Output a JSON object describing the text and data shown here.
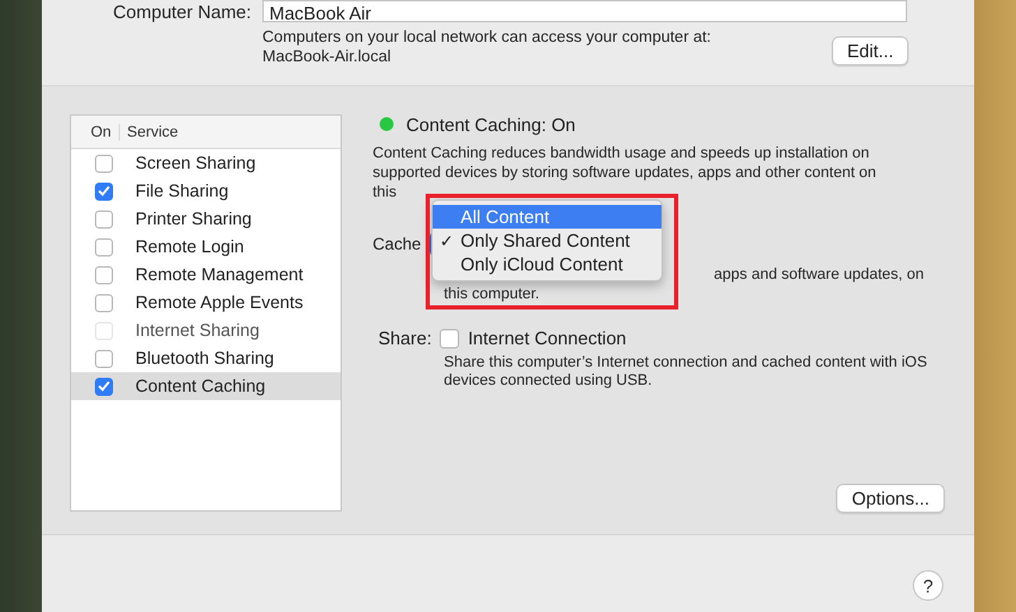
{
  "computer_name": {
    "label": "Computer Name:",
    "value": "MacBook Air"
  },
  "network_note": [
    "Computers on your local network can access your computer at:",
    "MacBook-Air.local"
  ],
  "edit_button": "Edit...",
  "services": {
    "columns": [
      "On",
      "Service"
    ],
    "rows": [
      {
        "name": "Screen Sharing",
        "checked": false,
        "disabled": false,
        "selected": false
      },
      {
        "name": "File Sharing",
        "checked": true,
        "disabled": false,
        "selected": false
      },
      {
        "name": "Printer Sharing",
        "checked": false,
        "disabled": false,
        "selected": false
      },
      {
        "name": "Remote Login",
        "checked": false,
        "disabled": false,
        "selected": false
      },
      {
        "name": "Remote Management",
        "checked": false,
        "disabled": false,
        "selected": false
      },
      {
        "name": "Remote Apple Events",
        "checked": false,
        "disabled": false,
        "selected": false
      },
      {
        "name": "Internet Sharing",
        "checked": false,
        "disabled": true,
        "selected": false
      },
      {
        "name": "Bluetooth Sharing",
        "checked": false,
        "disabled": false,
        "selected": false
      },
      {
        "name": "Content Caching",
        "checked": true,
        "disabled": false,
        "selected": true
      }
    ]
  },
  "status": {
    "text": "Content Caching: On",
    "color": "#28c840"
  },
  "description": "Content Caching reduces bandwidth usage and speeds up installation on supported devices by storing software updates, apps and other content on this",
  "cache": {
    "label": "Cache",
    "note": [
      "apps and software updates, on",
      "this computer."
    ]
  },
  "menu_check": "✓",
  "cache_menu": [
    {
      "label": "All Content",
      "selected": false,
      "highlighted": true
    },
    {
      "label": "Only Shared Content",
      "selected": true,
      "highlighted": false
    },
    {
      "label": "Only iCloud Content",
      "selected": false,
      "highlighted": false
    }
  ],
  "share": {
    "label": "Share:",
    "option": "Internet Connection",
    "checked": false,
    "note": "Share this computer’s Internet connection and cached content with iOS devices connected using USB."
  },
  "options_button": "Options...",
  "help_button": "?"
}
